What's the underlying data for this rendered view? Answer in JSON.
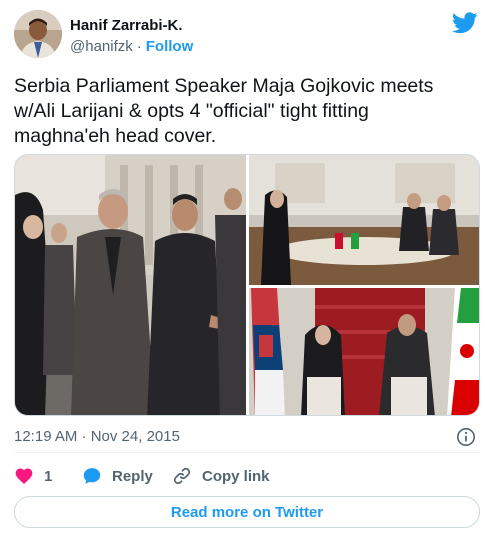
{
  "author": {
    "display_name": "Hanif Zarrabi-K.",
    "handle": "@hanifzk",
    "separator": "·",
    "follow_label": "Follow"
  },
  "tweet": {
    "text": "Serbia Parliament Speaker Maja Gojkovic meets w/Ali Larijani & opts 4 \"official\" tight fitting maghna'eh head cover."
  },
  "media": {
    "photos": [
      "photo-street-meeting",
      "photo-meeting-room",
      "photo-press-podium"
    ]
  },
  "meta": {
    "timestamp": "12:19 AM · Nov 24, 2015"
  },
  "actions": {
    "like_count": "1",
    "reply_label": "Reply",
    "copy_label": "Copy link"
  },
  "read_more_label": "Read more on Twitter",
  "colors": {
    "accent": "#1d9bf0",
    "like": "#f91880",
    "text": "#0f1419",
    "muted": "#536471"
  }
}
